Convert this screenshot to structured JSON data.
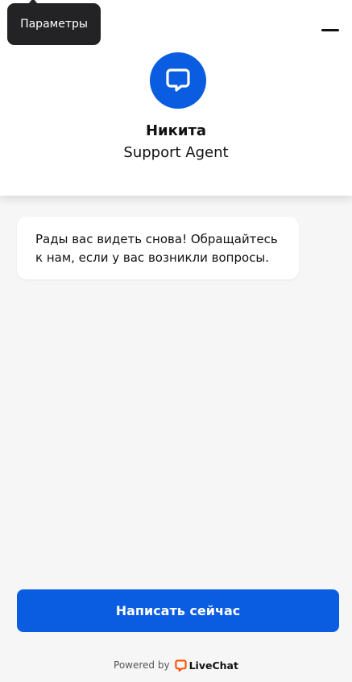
{
  "tooltip": {
    "text": "Параметры"
  },
  "header": {
    "minimize_icon": "minimize-icon",
    "avatar_icon": "chat-bubble-icon",
    "agent_name": "Никита",
    "agent_role": "Support Agent"
  },
  "messages": [
    {
      "text": "Рады вас видеть снова! Обращайтесь к нам, если у вас возникли вопросы."
    }
  ],
  "cta": {
    "label": "Написать сейчас"
  },
  "footer": {
    "powered_by": "Powered by",
    "brand": "LiveChat",
    "brand_icon": "livechat-logo-icon"
  },
  "colors": {
    "accent": "#0a5de0",
    "header_bg": "#ffffff",
    "body_bg": "#f6f6f7",
    "tooltip_bg": "#232325",
    "brand_orange": "#ff5100"
  }
}
